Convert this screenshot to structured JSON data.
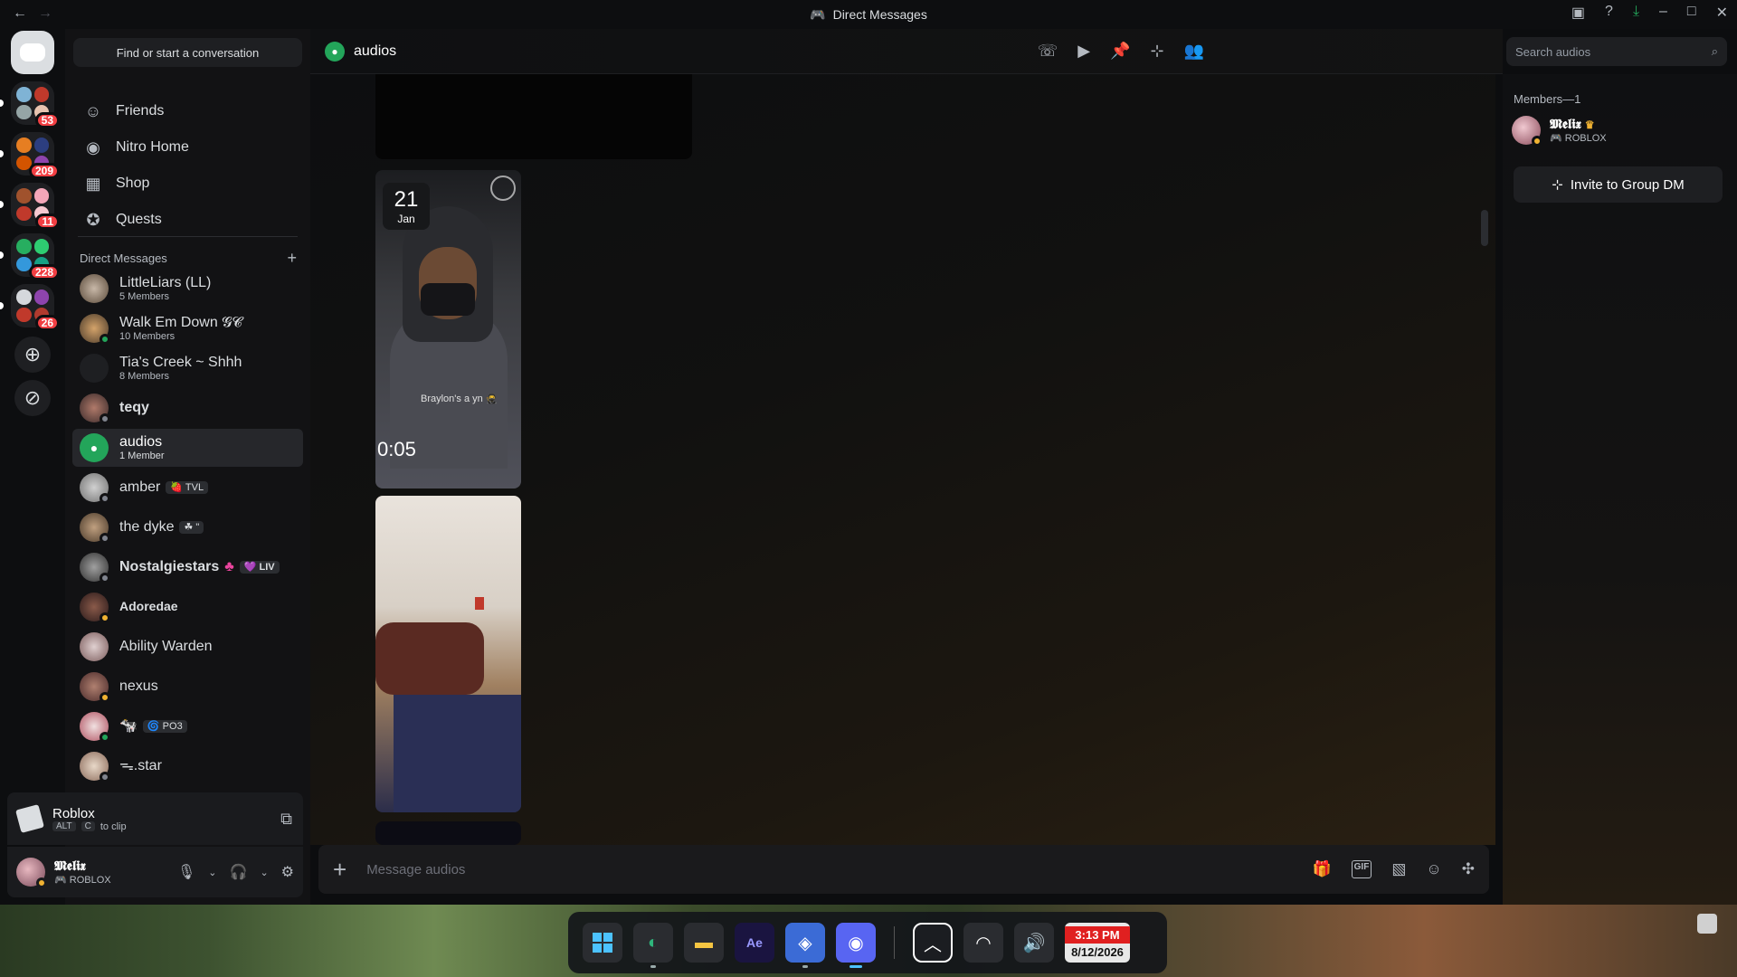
{
  "window": {
    "title": "Direct Messages"
  },
  "nav": {
    "search_label": "Find or start a conversation",
    "items": [
      {
        "label": "Friends",
        "icon": "friends-icon"
      },
      {
        "label": "Nitro Home",
        "icon": "nitro-icon"
      },
      {
        "label": "Shop",
        "icon": "shop-icon"
      },
      {
        "label": "Quests",
        "icon": "quests-icon"
      }
    ]
  },
  "guilds": {
    "badges": [
      "53",
      "209",
      "11",
      "228",
      "26"
    ]
  },
  "dm_section": {
    "title": "Direct Messages"
  },
  "dms": [
    {
      "name": "LittleLiars (LL)",
      "sub": "5 Members"
    },
    {
      "name": "Walk Em Down 𝓖𝓒",
      "sub": "10 Members"
    },
    {
      "name": "Tia's Creek ~ Shhh",
      "sub": "8 Members"
    },
    {
      "name": "teqy",
      "sub": ""
    },
    {
      "name": "audios",
      "sub": "1 Member"
    },
    {
      "name": "amber",
      "sub": "",
      "tag": "🍓 TVL"
    },
    {
      "name": "the dyke",
      "sub": "",
      "tag": "☘ \""
    },
    {
      "name": "Nostalgiestars",
      "sub": "",
      "tag": "💜 LIV"
    },
    {
      "name": "Adoredae",
      "sub": ""
    },
    {
      "name": "Ability Warden",
      "sub": ""
    },
    {
      "name": "nexus",
      "sub": ""
    },
    {
      "name": "🐄",
      "sub": "",
      "tag": "🌀 PO3"
    },
    {
      "name": "ᯓ.star",
      "sub": ""
    }
  ],
  "activity": {
    "game": "Roblox",
    "key1": "ALT",
    "key2": "C",
    "hint": "to clip"
  },
  "user": {
    "name": "𝕸𝖊𝖑𝖎𝖝",
    "status": "ROBLOX"
  },
  "chat": {
    "channel_name": "audios",
    "search_placeholder": "Search audios",
    "composer_placeholder": "Message audios",
    "media": [
      {
        "day": "21",
        "month": "Jan",
        "duration": "0:05",
        "caption": "Braylon's a yn 🥷"
      }
    ]
  },
  "members": {
    "header": "Members—1",
    "list": [
      {
        "name": "𝕸𝖊𝖑𝖎𝖝",
        "status": "ROBLOX"
      }
    ],
    "invite_label": "Invite to Group DM"
  },
  "taskbar": {
    "time": "3:13 PM",
    "date": "8/12/2026"
  }
}
